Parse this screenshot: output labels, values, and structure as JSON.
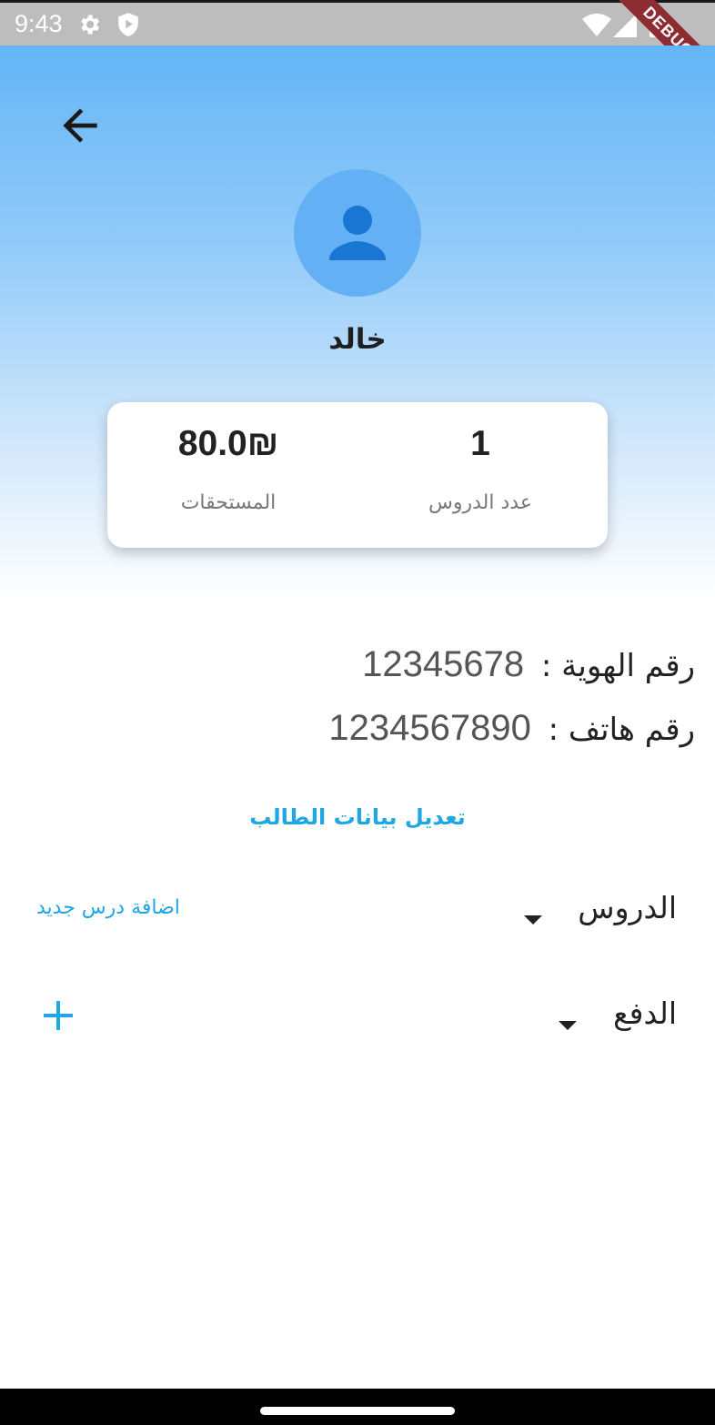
{
  "status_bar": {
    "time": "9:43",
    "debug_label": "DEBUG",
    "icons": [
      "gear-icon",
      "shield-play-icon",
      "wifi-icon",
      "signal-icon",
      "battery-icon"
    ]
  },
  "header": {
    "back_icon": "arrow-back-icon",
    "avatar_icon": "person-icon",
    "student_name": "خالد"
  },
  "stats": {
    "lessons_count": "1",
    "lessons_label": "عدد الدروس",
    "dues_value": "80.0₪",
    "dues_label": "المستحقات"
  },
  "info": {
    "id_label": "رقم الهوية :",
    "id_value": "12345678",
    "phone_label": "رقم هاتف :",
    "phone_value": "1234567890"
  },
  "actions": {
    "edit_student": "تعديل بيانات الطالب",
    "add_lesson": "اضافة درس جديد"
  },
  "sections": {
    "lessons_title": "الدروس",
    "payment_title": "الدفع"
  },
  "colors": {
    "accent": "#1ea7e4",
    "header_top": "#64b5f6",
    "avatar": "#64b0f4",
    "avatar_icon": "#1976d2",
    "debug_banner": "#8d2c33"
  }
}
